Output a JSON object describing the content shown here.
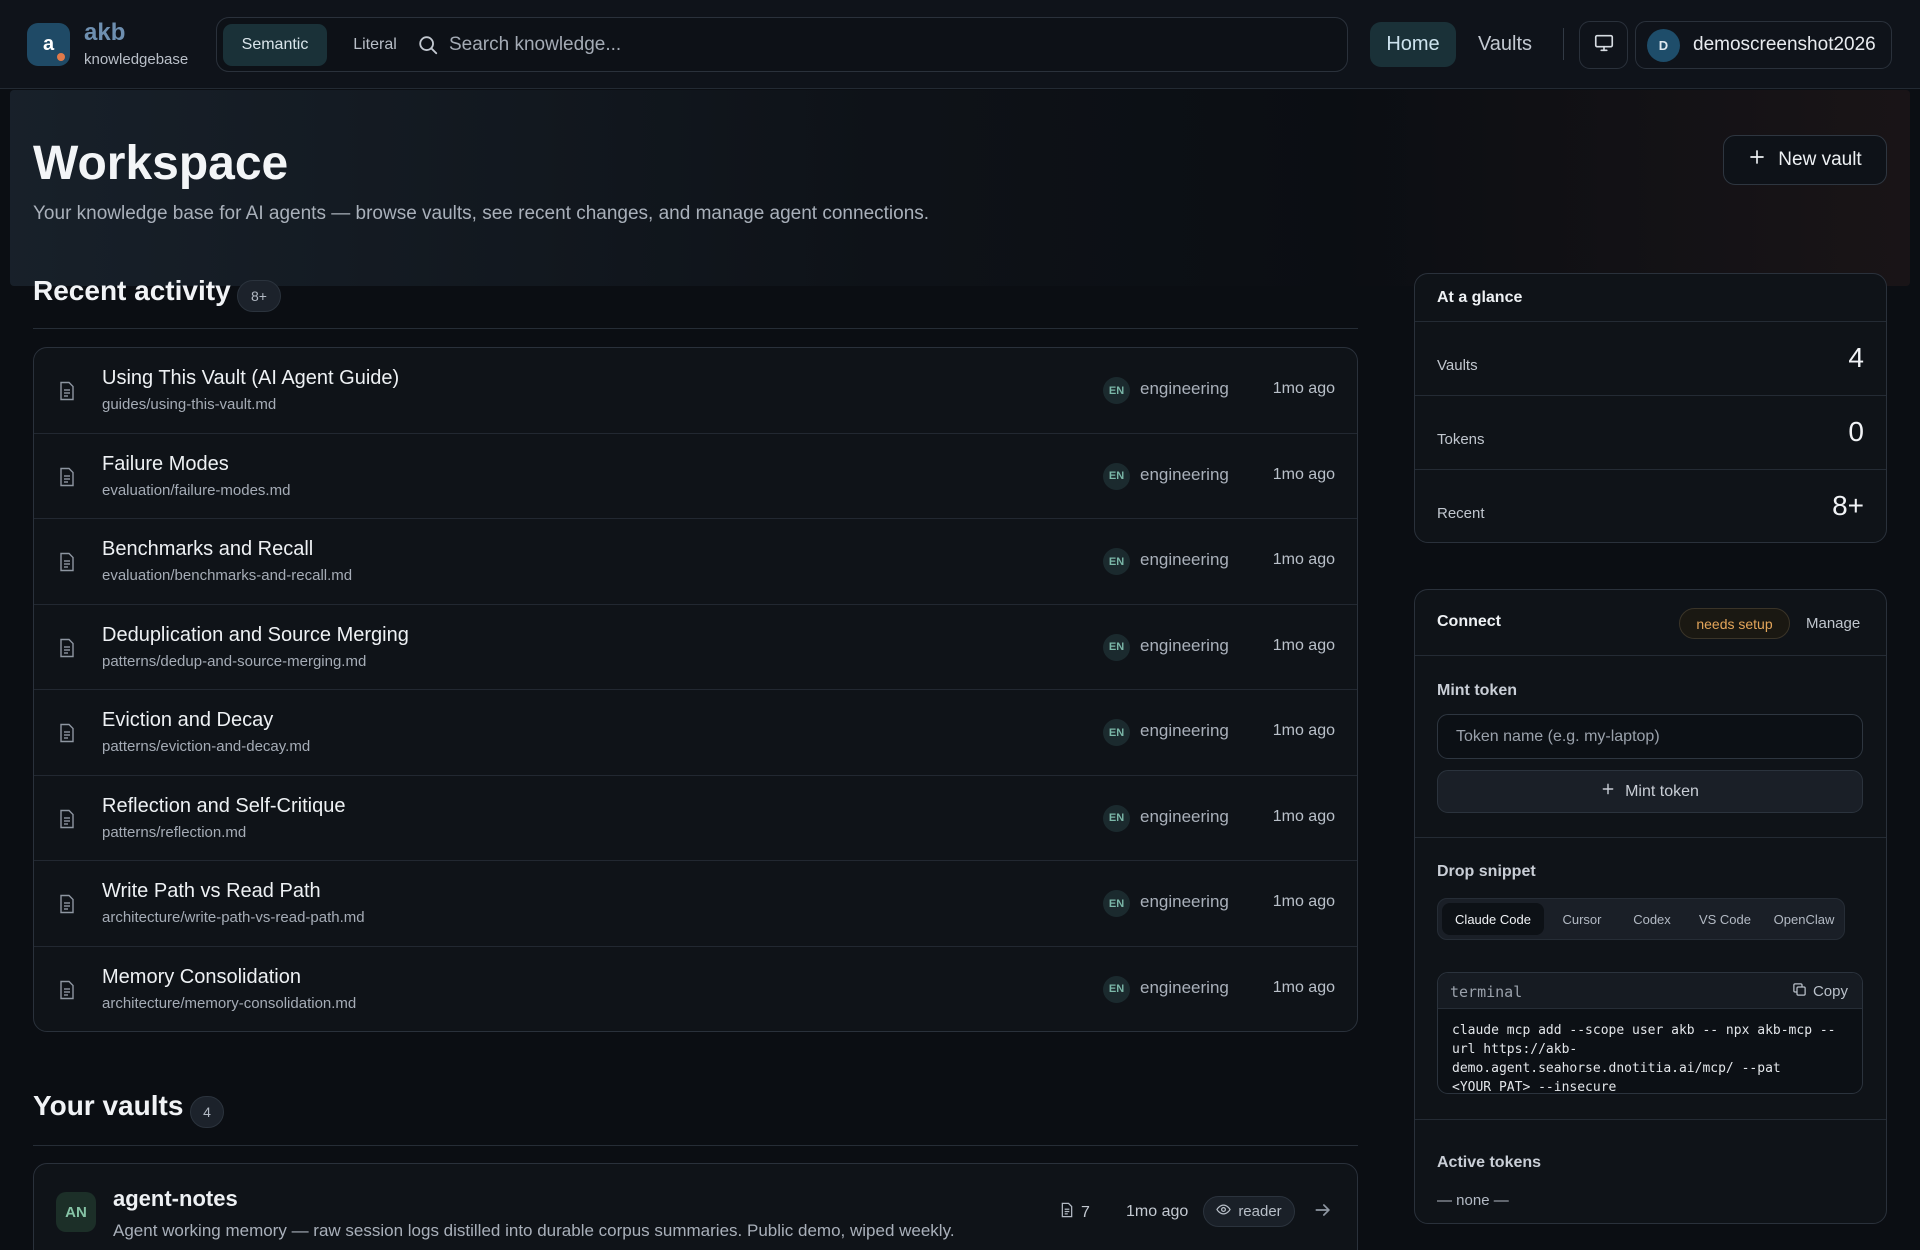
{
  "app": {
    "logo_letter": "a",
    "name": "akb",
    "subtitle": "knowledgebase",
    "accent_color": "#1f4a66",
    "warn_color": "#e3a55a"
  },
  "search": {
    "mode_semantic": "Semantic",
    "mode_literal": "Literal",
    "active_mode": "Semantic",
    "placeholder": "Search knowledge...",
    "value": ""
  },
  "nav": {
    "home": "Home",
    "vaults": "Vaults",
    "active": "Home",
    "display_icon": "monitor-icon"
  },
  "user": {
    "initial": "D",
    "name": "demoscreenshot2026"
  },
  "page": {
    "title": "Workspace",
    "subtitle": "Your knowledge base for AI agents — browse vaults, see recent changes, and manage agent connections.",
    "new_vault_label": "New vault"
  },
  "recent": {
    "title": "Recent activity",
    "count": "8+",
    "items": [
      {
        "title": "Using This Vault (AI Agent Guide)",
        "path": "guides/using-this-vault.md",
        "lang": "EN",
        "vault": "engineering",
        "time": "1mo ago"
      },
      {
        "title": "Failure Modes",
        "path": "evaluation/failure-modes.md",
        "lang": "EN",
        "vault": "engineering",
        "time": "1mo ago"
      },
      {
        "title": "Benchmarks and Recall",
        "path": "evaluation/benchmarks-and-recall.md",
        "lang": "EN",
        "vault": "engineering",
        "time": "1mo ago"
      },
      {
        "title": "Deduplication and Source Merging",
        "path": "patterns/dedup-and-source-merging.md",
        "lang": "EN",
        "vault": "engineering",
        "time": "1mo ago"
      },
      {
        "title": "Eviction and Decay",
        "path": "patterns/eviction-and-decay.md",
        "lang": "EN",
        "vault": "engineering",
        "time": "1mo ago"
      },
      {
        "title": "Reflection and Self-Critique",
        "path": "patterns/reflection.md",
        "lang": "EN",
        "vault": "engineering",
        "time": "1mo ago"
      },
      {
        "title": "Write Path vs Read Path",
        "path": "architecture/write-path-vs-read-path.md",
        "lang": "EN",
        "vault": "engineering",
        "time": "1mo ago"
      },
      {
        "title": "Memory Consolidation",
        "path": "architecture/memory-consolidation.md",
        "lang": "EN",
        "vault": "engineering",
        "time": "1mo ago"
      }
    ]
  },
  "vaults": {
    "title": "Your vaults",
    "count": "4",
    "items": [
      {
        "initials": "AN",
        "name": "agent-notes",
        "description": "Agent working memory — raw session logs distilled into durable corpus summaries. Public demo, wiped weekly.",
        "doc_count": "7",
        "time": "1mo ago",
        "role": "reader"
      }
    ]
  },
  "glance": {
    "title": "At a glance",
    "rows": [
      {
        "label": "Vaults",
        "value": "4"
      },
      {
        "label": "Tokens",
        "value": "0"
      },
      {
        "label": "Recent",
        "value": "8+"
      }
    ]
  },
  "connect": {
    "title": "Connect",
    "status": "needs setup",
    "manage": "Manage",
    "mint_title": "Mint token",
    "token_placeholder": "Token name (e.g. my-laptop)",
    "token_value": "",
    "mint_button": "Mint token",
    "snippet_title": "Drop snippet",
    "tabs": [
      "Claude Code",
      "Cursor",
      "Codex",
      "VS Code",
      "OpenClaw"
    ],
    "active_tab": "Claude Code",
    "code_label": "terminal",
    "copy_label": "Copy",
    "code": "claude mcp add --scope user akb -- npx akb-mcp --url https://akb-demo.agent.seahorse.dnotitia.ai/mcp/ --pat <YOUR_PAT> --insecure",
    "active_tokens_title": "Active tokens",
    "active_tokens_empty": "— none —"
  }
}
